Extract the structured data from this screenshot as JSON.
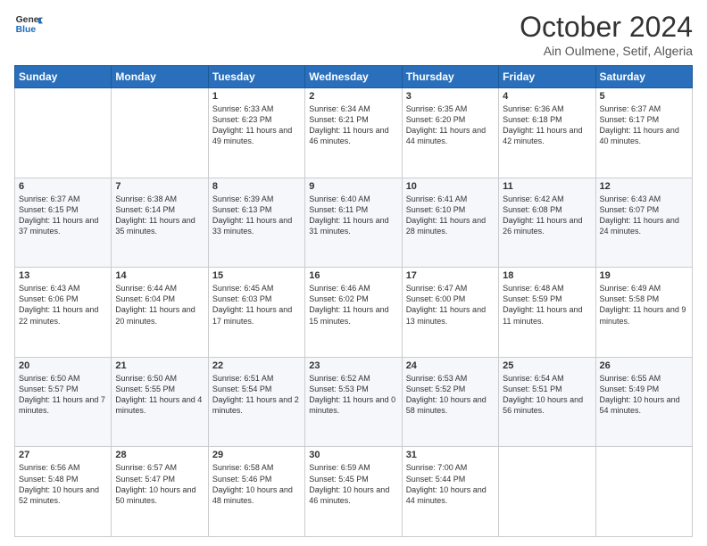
{
  "header": {
    "logo_line1": "General",
    "logo_line2": "Blue",
    "month": "October 2024",
    "location": "Ain Oulmene, Setif, Algeria"
  },
  "weekdays": [
    "Sunday",
    "Monday",
    "Tuesday",
    "Wednesday",
    "Thursday",
    "Friday",
    "Saturday"
  ],
  "weeks": [
    [
      {
        "day": "",
        "sunrise": "",
        "sunset": "",
        "daylight": ""
      },
      {
        "day": "",
        "sunrise": "",
        "sunset": "",
        "daylight": ""
      },
      {
        "day": "1",
        "sunrise": "Sunrise: 6:33 AM",
        "sunset": "Sunset: 6:23 PM",
        "daylight": "Daylight: 11 hours and 49 minutes."
      },
      {
        "day": "2",
        "sunrise": "Sunrise: 6:34 AM",
        "sunset": "Sunset: 6:21 PM",
        "daylight": "Daylight: 11 hours and 46 minutes."
      },
      {
        "day": "3",
        "sunrise": "Sunrise: 6:35 AM",
        "sunset": "Sunset: 6:20 PM",
        "daylight": "Daylight: 11 hours and 44 minutes."
      },
      {
        "day": "4",
        "sunrise": "Sunrise: 6:36 AM",
        "sunset": "Sunset: 6:18 PM",
        "daylight": "Daylight: 11 hours and 42 minutes."
      },
      {
        "day": "5",
        "sunrise": "Sunrise: 6:37 AM",
        "sunset": "Sunset: 6:17 PM",
        "daylight": "Daylight: 11 hours and 40 minutes."
      }
    ],
    [
      {
        "day": "6",
        "sunrise": "Sunrise: 6:37 AM",
        "sunset": "Sunset: 6:15 PM",
        "daylight": "Daylight: 11 hours and 37 minutes."
      },
      {
        "day": "7",
        "sunrise": "Sunrise: 6:38 AM",
        "sunset": "Sunset: 6:14 PM",
        "daylight": "Daylight: 11 hours and 35 minutes."
      },
      {
        "day": "8",
        "sunrise": "Sunrise: 6:39 AM",
        "sunset": "Sunset: 6:13 PM",
        "daylight": "Daylight: 11 hours and 33 minutes."
      },
      {
        "day": "9",
        "sunrise": "Sunrise: 6:40 AM",
        "sunset": "Sunset: 6:11 PM",
        "daylight": "Daylight: 11 hours and 31 minutes."
      },
      {
        "day": "10",
        "sunrise": "Sunrise: 6:41 AM",
        "sunset": "Sunset: 6:10 PM",
        "daylight": "Daylight: 11 hours and 28 minutes."
      },
      {
        "day": "11",
        "sunrise": "Sunrise: 6:42 AM",
        "sunset": "Sunset: 6:08 PM",
        "daylight": "Daylight: 11 hours and 26 minutes."
      },
      {
        "day": "12",
        "sunrise": "Sunrise: 6:43 AM",
        "sunset": "Sunset: 6:07 PM",
        "daylight": "Daylight: 11 hours and 24 minutes."
      }
    ],
    [
      {
        "day": "13",
        "sunrise": "Sunrise: 6:43 AM",
        "sunset": "Sunset: 6:06 PM",
        "daylight": "Daylight: 11 hours and 22 minutes."
      },
      {
        "day": "14",
        "sunrise": "Sunrise: 6:44 AM",
        "sunset": "Sunset: 6:04 PM",
        "daylight": "Daylight: 11 hours and 20 minutes."
      },
      {
        "day": "15",
        "sunrise": "Sunrise: 6:45 AM",
        "sunset": "Sunset: 6:03 PM",
        "daylight": "Daylight: 11 hours and 17 minutes."
      },
      {
        "day": "16",
        "sunrise": "Sunrise: 6:46 AM",
        "sunset": "Sunset: 6:02 PM",
        "daylight": "Daylight: 11 hours and 15 minutes."
      },
      {
        "day": "17",
        "sunrise": "Sunrise: 6:47 AM",
        "sunset": "Sunset: 6:00 PM",
        "daylight": "Daylight: 11 hours and 13 minutes."
      },
      {
        "day": "18",
        "sunrise": "Sunrise: 6:48 AM",
        "sunset": "Sunset: 5:59 PM",
        "daylight": "Daylight: 11 hours and 11 minutes."
      },
      {
        "day": "19",
        "sunrise": "Sunrise: 6:49 AM",
        "sunset": "Sunset: 5:58 PM",
        "daylight": "Daylight: 11 hours and 9 minutes."
      }
    ],
    [
      {
        "day": "20",
        "sunrise": "Sunrise: 6:50 AM",
        "sunset": "Sunset: 5:57 PM",
        "daylight": "Daylight: 11 hours and 7 minutes."
      },
      {
        "day": "21",
        "sunrise": "Sunrise: 6:50 AM",
        "sunset": "Sunset: 5:55 PM",
        "daylight": "Daylight: 11 hours and 4 minutes."
      },
      {
        "day": "22",
        "sunrise": "Sunrise: 6:51 AM",
        "sunset": "Sunset: 5:54 PM",
        "daylight": "Daylight: 11 hours and 2 minutes."
      },
      {
        "day": "23",
        "sunrise": "Sunrise: 6:52 AM",
        "sunset": "Sunset: 5:53 PM",
        "daylight": "Daylight: 11 hours and 0 minutes."
      },
      {
        "day": "24",
        "sunrise": "Sunrise: 6:53 AM",
        "sunset": "Sunset: 5:52 PM",
        "daylight": "Daylight: 10 hours and 58 minutes."
      },
      {
        "day": "25",
        "sunrise": "Sunrise: 6:54 AM",
        "sunset": "Sunset: 5:51 PM",
        "daylight": "Daylight: 10 hours and 56 minutes."
      },
      {
        "day": "26",
        "sunrise": "Sunrise: 6:55 AM",
        "sunset": "Sunset: 5:49 PM",
        "daylight": "Daylight: 10 hours and 54 minutes."
      }
    ],
    [
      {
        "day": "27",
        "sunrise": "Sunrise: 6:56 AM",
        "sunset": "Sunset: 5:48 PM",
        "daylight": "Daylight: 10 hours and 52 minutes."
      },
      {
        "day": "28",
        "sunrise": "Sunrise: 6:57 AM",
        "sunset": "Sunset: 5:47 PM",
        "daylight": "Daylight: 10 hours and 50 minutes."
      },
      {
        "day": "29",
        "sunrise": "Sunrise: 6:58 AM",
        "sunset": "Sunset: 5:46 PM",
        "daylight": "Daylight: 10 hours and 48 minutes."
      },
      {
        "day": "30",
        "sunrise": "Sunrise: 6:59 AM",
        "sunset": "Sunset: 5:45 PM",
        "daylight": "Daylight: 10 hours and 46 minutes."
      },
      {
        "day": "31",
        "sunrise": "Sunrise: 7:00 AM",
        "sunset": "Sunset: 5:44 PM",
        "daylight": "Daylight: 10 hours and 44 minutes."
      },
      {
        "day": "",
        "sunrise": "",
        "sunset": "",
        "daylight": ""
      },
      {
        "day": "",
        "sunrise": "",
        "sunset": "",
        "daylight": ""
      }
    ]
  ]
}
